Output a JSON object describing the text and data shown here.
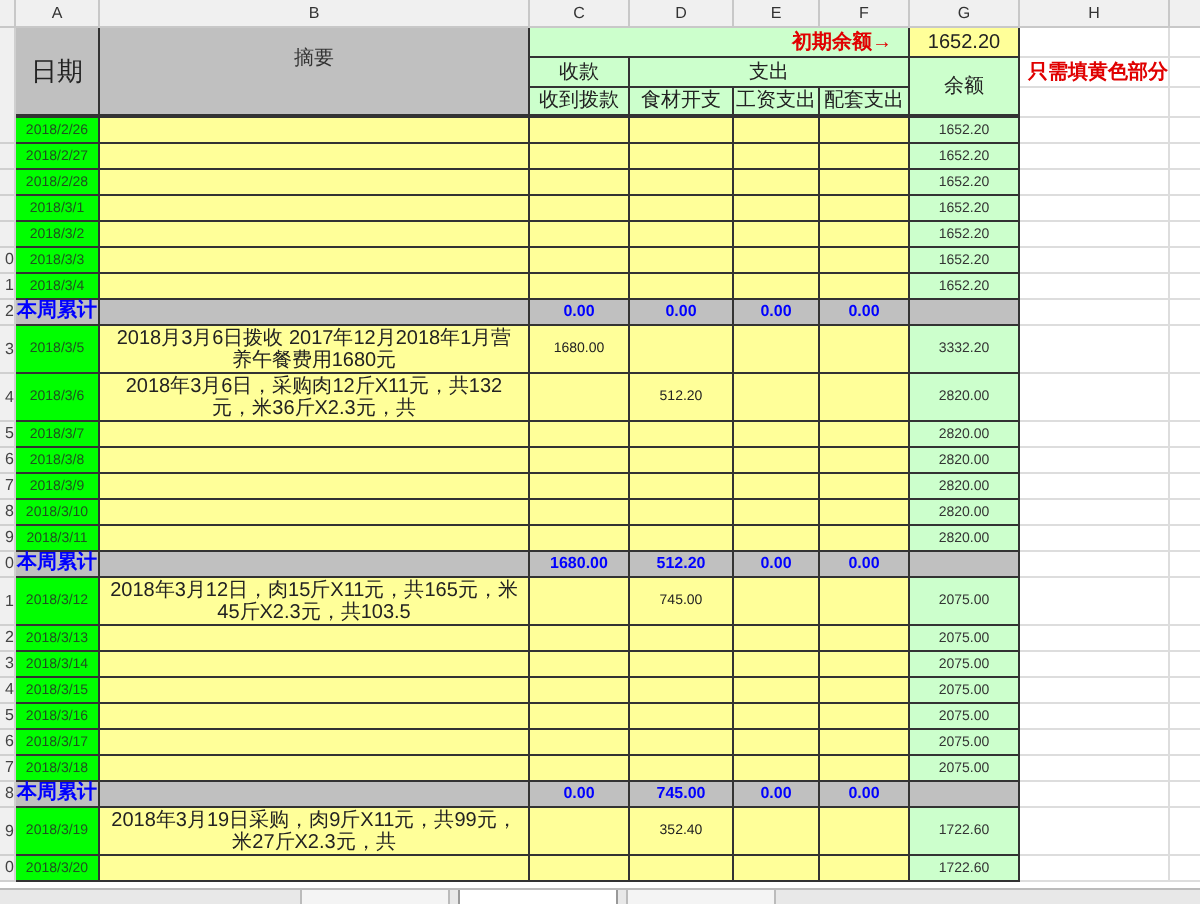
{
  "column_headers": [
    "A",
    "B",
    "C",
    "D",
    "E",
    "F",
    "G",
    "H"
  ],
  "header": {
    "date_label": "日期",
    "summary_label": "摘要",
    "opening_balance_label": "初期余额→",
    "opening_balance": "1652.20",
    "income_label": "收款",
    "expense_label": "支出",
    "balance_label": "余额",
    "note": "只需填黄色部分",
    "subcolumns": [
      "收到拨款",
      "食材开支",
      "工资支出",
      "配套支出"
    ]
  },
  "rows": [
    {
      "kind": "day",
      "date": "2018/2/26",
      "balance": "1652.20"
    },
    {
      "kind": "day",
      "date": "2018/2/27",
      "balance": "1652.20"
    },
    {
      "kind": "day",
      "date": "2018/2/28",
      "balance": "1652.20"
    },
    {
      "kind": "day",
      "date": "2018/3/1",
      "balance": "1652.20"
    },
    {
      "kind": "day",
      "date": "2018/3/2",
      "balance": "1652.20"
    },
    {
      "kind": "day",
      "row_number": "0",
      "date": "2018/3/3",
      "balance": "1652.20"
    },
    {
      "kind": "day",
      "row_number": "1",
      "date": "2018/3/4",
      "balance": "1652.20"
    },
    {
      "kind": "total",
      "row_number": "2",
      "label": "本周累计",
      "amounts": [
        "0.00",
        "0.00",
        "0.00",
        "0.00"
      ]
    },
    {
      "kind": "day",
      "row_number": "3",
      "date": "2018/3/5",
      "summary": "2018月3月6日拨收 2017年12月2018年1月营养午餐费用1680元",
      "amounts": {
        "income": "1680.00"
      },
      "balance": "3332.20"
    },
    {
      "kind": "day",
      "row_number": "4",
      "date": "2018/3/6",
      "summary": "2018年3月6日，采购肉12斤X11元，共132元，米36斤X2.3元，共",
      "amounts": {
        "food": "512.20"
      },
      "balance": "2820.00"
    },
    {
      "kind": "day",
      "row_number": "5",
      "date": "2018/3/7",
      "balance": "2820.00"
    },
    {
      "kind": "day",
      "row_number": "6",
      "date": "2018/3/8",
      "balance": "2820.00"
    },
    {
      "kind": "day",
      "row_number": "7",
      "date": "2018/3/9",
      "balance": "2820.00"
    },
    {
      "kind": "day",
      "row_number": "8",
      "date": "2018/3/10",
      "balance": "2820.00"
    },
    {
      "kind": "day",
      "row_number": "9",
      "date": "2018/3/11",
      "balance": "2820.00"
    },
    {
      "kind": "total",
      "row_number": "0",
      "label": "本周累计",
      "amounts": [
        "1680.00",
        "512.20",
        "0.00",
        "0.00"
      ]
    },
    {
      "kind": "day",
      "row_number": "1",
      "date": "2018/3/12",
      "summary": "2018年3月12日，肉15斤X11元，共165元，米45斤X2.3元，共103.5",
      "amounts": {
        "food": "745.00"
      },
      "balance": "2075.00"
    },
    {
      "kind": "day",
      "row_number": "2",
      "date": "2018/3/13",
      "balance": "2075.00"
    },
    {
      "kind": "day",
      "row_number": "3",
      "date": "2018/3/14",
      "balance": "2075.00"
    },
    {
      "kind": "day",
      "row_number": "4",
      "date": "2018/3/15",
      "balance": "2075.00"
    },
    {
      "kind": "day",
      "row_number": "5",
      "date": "2018/3/16",
      "balance": "2075.00"
    },
    {
      "kind": "day",
      "row_number": "6",
      "date": "2018/3/17",
      "balance": "2075.00"
    },
    {
      "kind": "day",
      "row_number": "7",
      "date": "2018/3/18",
      "balance": "2075.00"
    },
    {
      "kind": "total",
      "row_number": "8",
      "label": "本周累计",
      "amounts": [
        "0.00",
        "745.00",
        "0.00",
        "0.00"
      ]
    },
    {
      "kind": "day",
      "row_number": "9",
      "date": "2018/3/19",
      "summary": "2018年3月19日采购，肉9斤X11元，共99元，米27斤X2.3元，共",
      "amounts": {
        "food": "352.40"
      },
      "balance": "1722.60"
    },
    {
      "kind": "day",
      "row_number": "0",
      "date": "2018/3/20",
      "balance": "1722.60"
    }
  ],
  "sheet_tabs": [
    {
      "selected": false
    },
    {
      "selected": true
    },
    {
      "selected": false
    }
  ]
}
